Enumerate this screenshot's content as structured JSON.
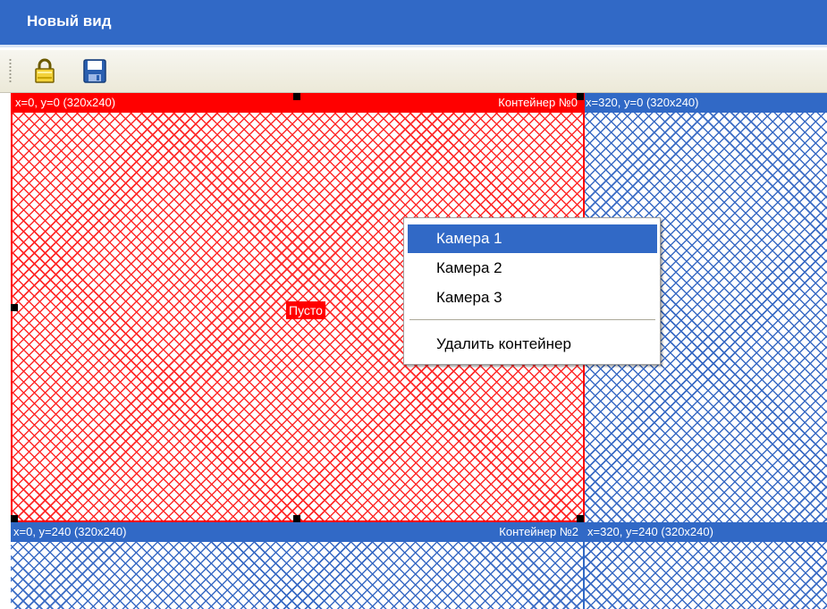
{
  "window": {
    "title": "Новый вид"
  },
  "toolbar": {
    "buttons": [
      {
        "icon": "lock-icon"
      },
      {
        "icon": "save-icon"
      }
    ]
  },
  "containers": [
    {
      "coords": "x=0, y=0 (320x240)",
      "name": "Контейнер №0",
      "status": "Пусто",
      "selected": true,
      "color": "#ff0000"
    },
    {
      "coords": "x=320, y=0 (320x240)",
      "name": "",
      "selected": false,
      "color": "#3169c6"
    },
    {
      "coords": "x=0, y=240 (320x240)",
      "name": "Контейнер №2",
      "selected": false,
      "color": "#3169c6"
    },
    {
      "coords": "x=320, y=240 (320x240)",
      "name": "",
      "selected": false,
      "color": "#3169c6"
    }
  ],
  "context_menu": {
    "items": [
      {
        "label": "Камера 1",
        "highlighted": true
      },
      {
        "label": "Камера 2"
      },
      {
        "label": "Камера 3"
      }
    ],
    "delete_label": "Удалить контейнер"
  }
}
